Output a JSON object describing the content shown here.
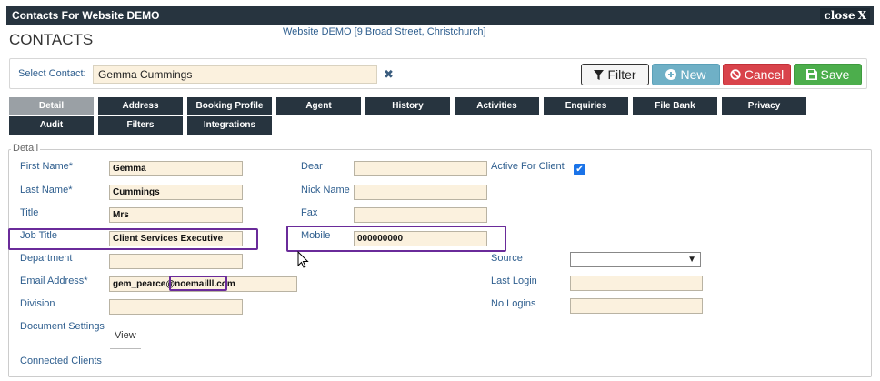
{
  "window": {
    "title": "Contacts For Website DEMO",
    "close_label": "close",
    "close_glyph": "X"
  },
  "page": {
    "heading": "CONTACTS",
    "site": "Website DEMO [9 Broad Street, Christchurch]"
  },
  "select_contact": {
    "label": "Select Contact:",
    "value": "Gemma Cummings",
    "clear_glyph": "✖"
  },
  "toolbar": {
    "filter_label": "Filter",
    "filter_icon": "filter-icon",
    "new_label": "New",
    "new_icon": "plus-circle-icon",
    "cancel_label": "Cancel",
    "cancel_icon": "ban-icon",
    "save_label": "Save",
    "save_icon": "floppy-icon"
  },
  "tabs": [
    {
      "label": "Detail",
      "active": true
    },
    {
      "label": "Address"
    },
    {
      "label": "Booking Profile"
    },
    {
      "label": "Agent"
    },
    {
      "label": "History"
    },
    {
      "label": "Activities"
    },
    {
      "label": "Enquiries"
    },
    {
      "label": "File Bank"
    },
    {
      "label": "Privacy"
    },
    {
      "label": "Audit"
    },
    {
      "label": "Filters"
    },
    {
      "label": "Integrations"
    }
  ],
  "detail": {
    "legend": "Detail",
    "first_name": {
      "label": "First Name*",
      "value": "Gemma"
    },
    "last_name": {
      "label": "Last Name*",
      "value": "Cummings"
    },
    "title": {
      "label": "Title",
      "value": "Mrs"
    },
    "job_title": {
      "label": "Job Title",
      "value": "Client Services Executive"
    },
    "department": {
      "label": "Department",
      "value": ""
    },
    "email": {
      "label": "Email Address*",
      "value": "gem_pearce@noemailll.com"
    },
    "division": {
      "label": "Division",
      "value": ""
    },
    "document_settings": {
      "label": "Document Settings",
      "link": "View"
    },
    "connected_clients": {
      "label": "Connected Clients"
    },
    "dear": {
      "label": "Dear",
      "value": ""
    },
    "nick_name": {
      "label": "Nick Name",
      "value": ""
    },
    "fax": {
      "label": "Fax",
      "value": ""
    },
    "mobile": {
      "label": "Mobile",
      "value": "000000000"
    },
    "active_for_client": {
      "label": "Active For Client",
      "checked": true
    },
    "source": {
      "label": "Source",
      "value": ""
    },
    "last_login": {
      "label": "Last Login",
      "value": ""
    },
    "no_logins": {
      "label": "No Logins",
      "value": ""
    }
  },
  "colors": {
    "titlebar": "#27343f",
    "tab": "#27343f",
    "tab_active": "#9aa0a5",
    "highlight": "#6a2b9a",
    "new": "#6fb0c6",
    "cancel": "#d9434b",
    "save": "#4cae4c",
    "label": "#2e5e8e",
    "input_bg": "#fbf1de"
  }
}
